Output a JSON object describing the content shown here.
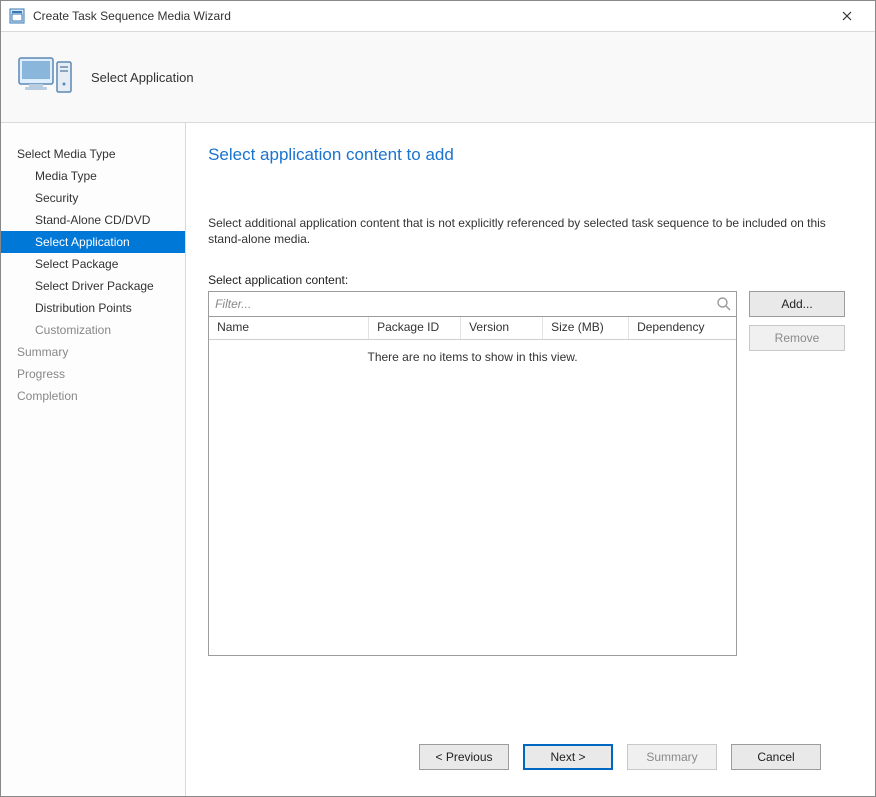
{
  "window": {
    "title": "Create Task Sequence Media Wizard"
  },
  "banner": {
    "title": "Select Application"
  },
  "sidebar": {
    "steps": [
      {
        "label": "Select Media Type",
        "sub": false,
        "selected": false,
        "disabled": false
      },
      {
        "label": "Media Type",
        "sub": true,
        "selected": false,
        "disabled": false
      },
      {
        "label": "Security",
        "sub": true,
        "selected": false,
        "disabled": false
      },
      {
        "label": "Stand-Alone CD/DVD",
        "sub": true,
        "selected": false,
        "disabled": false
      },
      {
        "label": "Select Application",
        "sub": true,
        "selected": true,
        "disabled": false
      },
      {
        "label": "Select Package",
        "sub": true,
        "selected": false,
        "disabled": false
      },
      {
        "label": "Select Driver Package",
        "sub": true,
        "selected": false,
        "disabled": false
      },
      {
        "label": "Distribution Points",
        "sub": true,
        "selected": false,
        "disabled": false
      },
      {
        "label": "Customization",
        "sub": true,
        "selected": false,
        "disabled": true
      },
      {
        "label": "Summary",
        "sub": false,
        "selected": false,
        "disabled": true
      },
      {
        "label": "Progress",
        "sub": false,
        "selected": false,
        "disabled": true
      },
      {
        "label": "Completion",
        "sub": false,
        "selected": false,
        "disabled": true
      }
    ]
  },
  "content": {
    "headline": "Select application content to add",
    "description": "Select additional application content that is not explicitly referenced by selected task sequence to be included on this stand-alone media.",
    "section_label": "Select application content:",
    "filter_placeholder": "Filter...",
    "columns": {
      "name": "Name",
      "package_id": "Package ID",
      "version": "Version",
      "size": "Size (MB)",
      "dependency": "Dependency"
    },
    "empty_text": "There are no items to show in this view.",
    "buttons": {
      "add": "Add...",
      "remove": "Remove"
    }
  },
  "footer": {
    "previous": "< Previous",
    "next": "Next >",
    "summary": "Summary",
    "cancel": "Cancel"
  }
}
